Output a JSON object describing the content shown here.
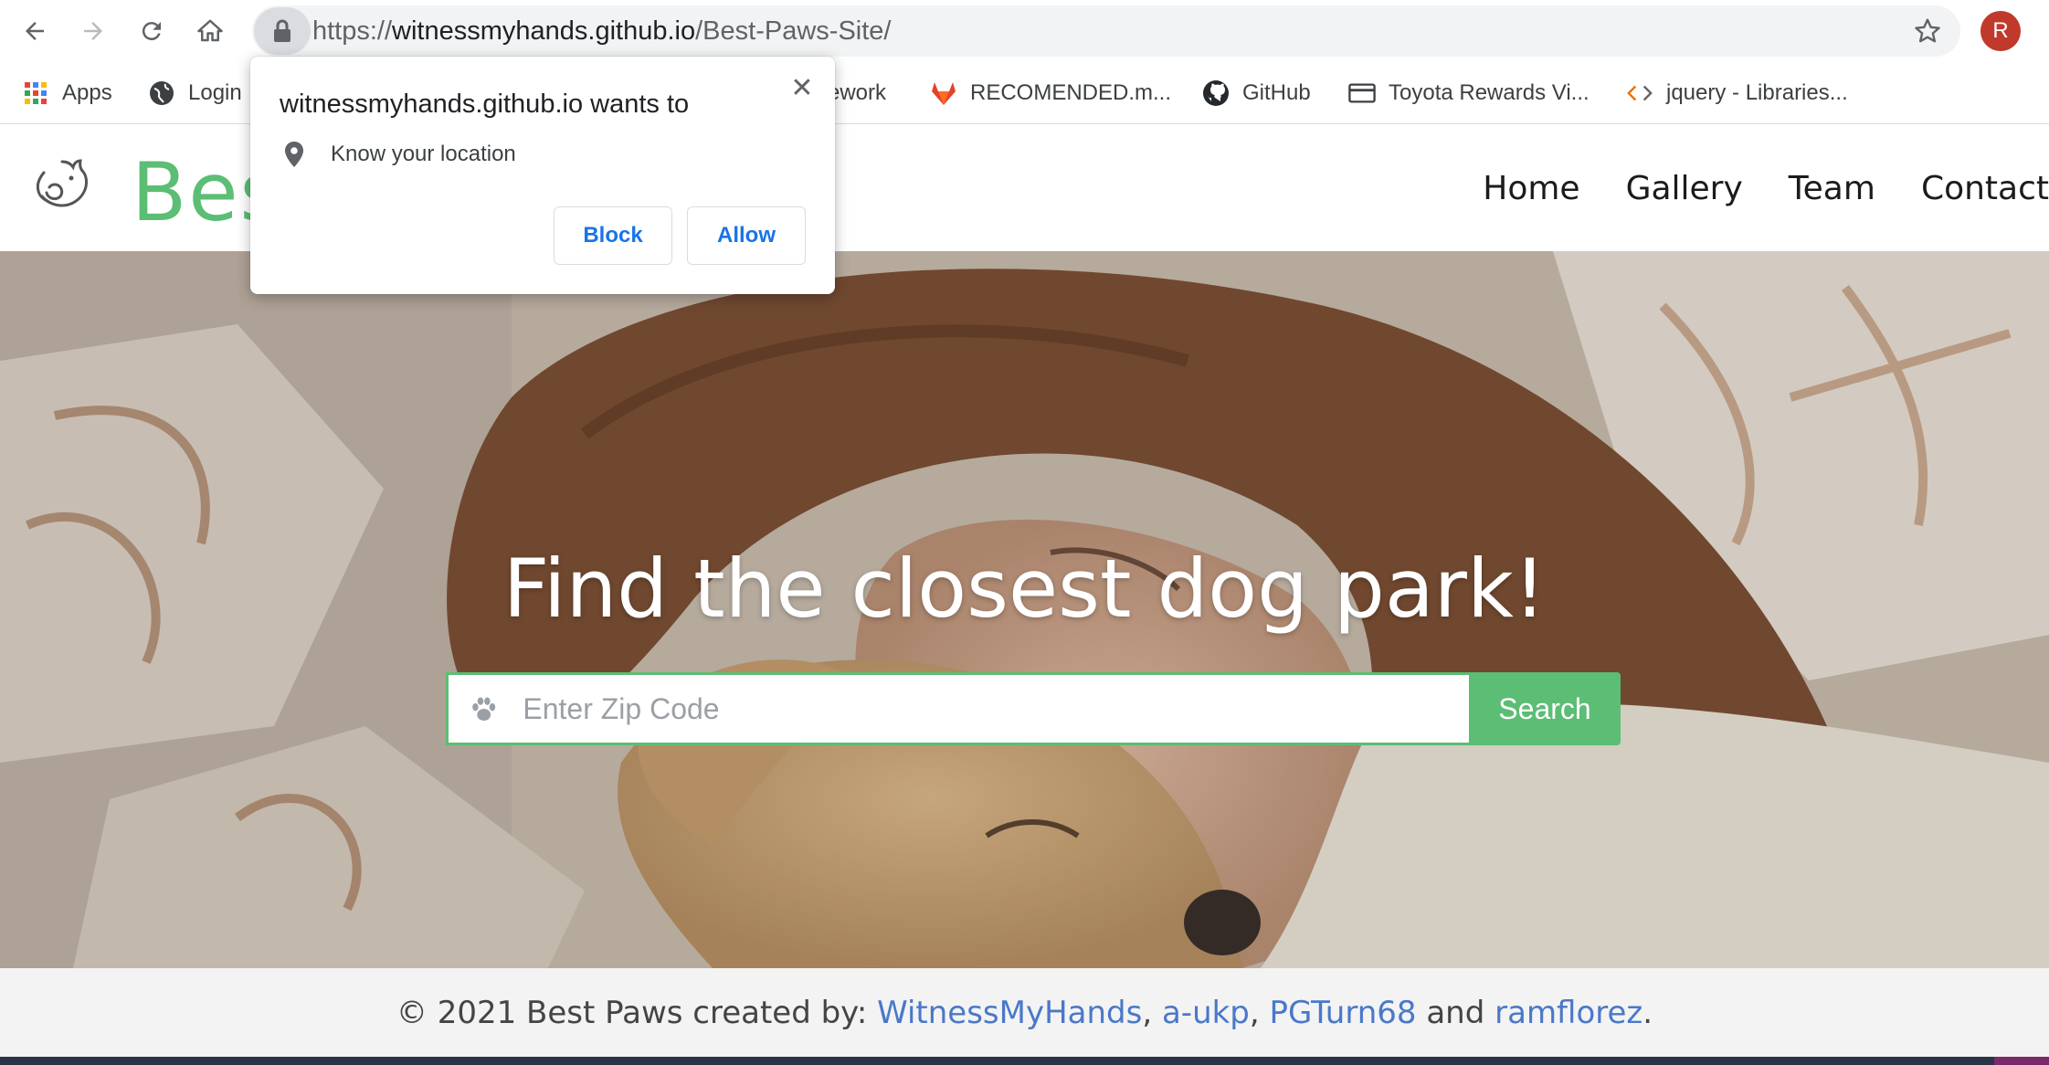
{
  "browser": {
    "url_prefix": "https://",
    "url_host": "witnessmyhands.github.io",
    "url_path": "/Best-Paws-Site/",
    "profile_initial": "R",
    "icons": {
      "back": "arrow-left-icon",
      "forward": "arrow-right-icon",
      "reload": "reload-icon",
      "home": "home-icon",
      "lock": "lock-icon",
      "bookmark": "star-icon"
    }
  },
  "bookmarks": [
    {
      "label": "Apps",
      "icon": "apps-grid-icon"
    },
    {
      "label": "Login",
      "icon": "globe-icon"
    },
    {
      "label": "ework",
      "icon": ""
    },
    {
      "label": "RECOMENDED.m...",
      "icon": "gitlab-icon"
    },
    {
      "label": "GitHub",
      "icon": "github-icon"
    },
    {
      "label": "Toyota Rewards Vi...",
      "icon": "card-icon"
    },
    {
      "label": "jquery - Libraries...",
      "icon": "code-icon"
    }
  ],
  "permission_popup": {
    "title": "witnessmyhands.github.io wants to",
    "request": "Know your location",
    "block_label": "Block",
    "allow_label": "Allow"
  },
  "site": {
    "brand": "Best Paws",
    "nav": [
      "Home",
      "Gallery",
      "Team",
      "Contact"
    ],
    "accent_color": "#5cbd74",
    "link_color": "#4a78c9"
  },
  "hero": {
    "title": "Find the closest dog park!",
    "search_placeholder": "Enter Zip Code",
    "search_value": "",
    "search_button": "Search"
  },
  "footer": {
    "prefix": "© 2021 Best Paws created by: ",
    "authors": [
      "WitnessMyHands",
      "a-ukp",
      "PGTurn68",
      "ramflorez"
    ],
    "sep1": ", ",
    "sep2": ", ",
    "and": " and ",
    "end": "."
  }
}
